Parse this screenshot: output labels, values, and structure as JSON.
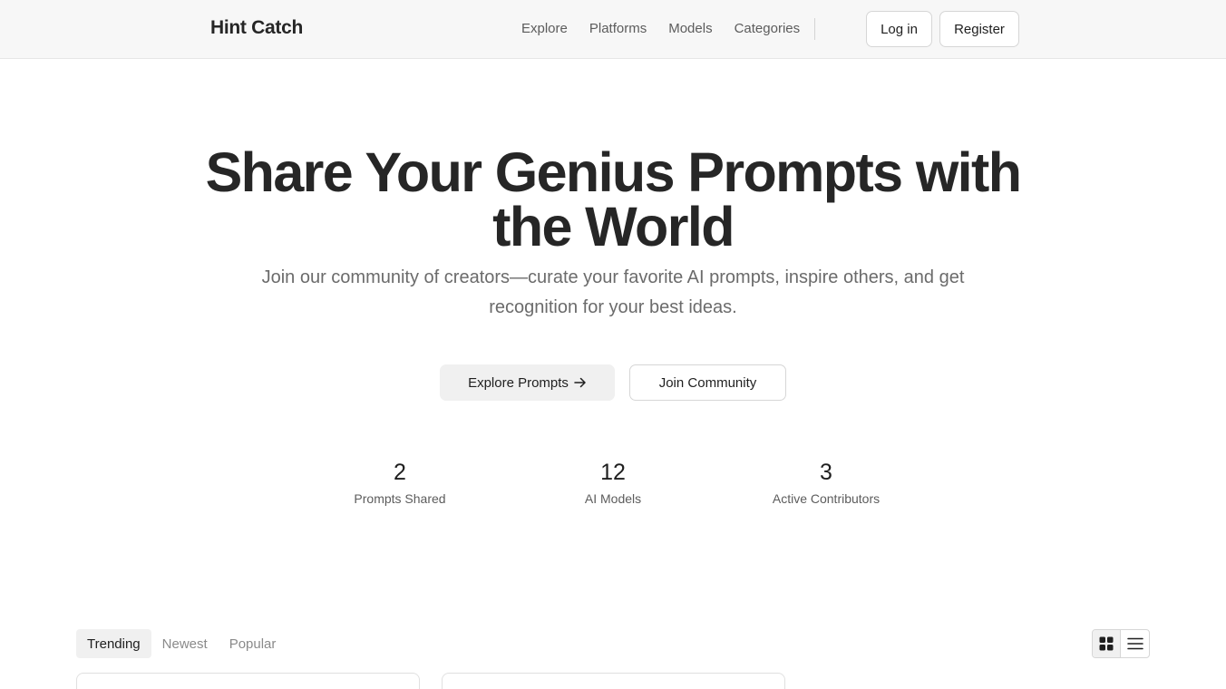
{
  "header": {
    "brand": "Hint Catch",
    "nav": [
      "Explore",
      "Platforms",
      "Models",
      "Categories"
    ],
    "login_label": "Log in",
    "register_label": "Register"
  },
  "hero": {
    "title": "Share Your Genius Prompts with the World",
    "subtitle": "Join our community of creators—curate your favorite AI prompts, inspire others, and get recognition for your best ideas.",
    "explore_label": "Explore Prompts",
    "join_label": "Join Community"
  },
  "stats": [
    {
      "value": "2",
      "label": "Prompts Shared"
    },
    {
      "value": "12",
      "label": "AI Models"
    },
    {
      "value": "3",
      "label": "Active Contributors"
    }
  ],
  "tabs": [
    "Trending",
    "Newest",
    "Popular"
  ],
  "active_tab": "Trending",
  "view_mode": "grid",
  "icons": [
    "arrow-right-icon",
    "grid-view-icon",
    "list-view-icon"
  ],
  "colors": {
    "text": "#262626",
    "muted": "#6b6b6b",
    "header_bg": "#f7f7f7",
    "button_bg": "#f0f0f0",
    "border": "#d6d6d6"
  }
}
